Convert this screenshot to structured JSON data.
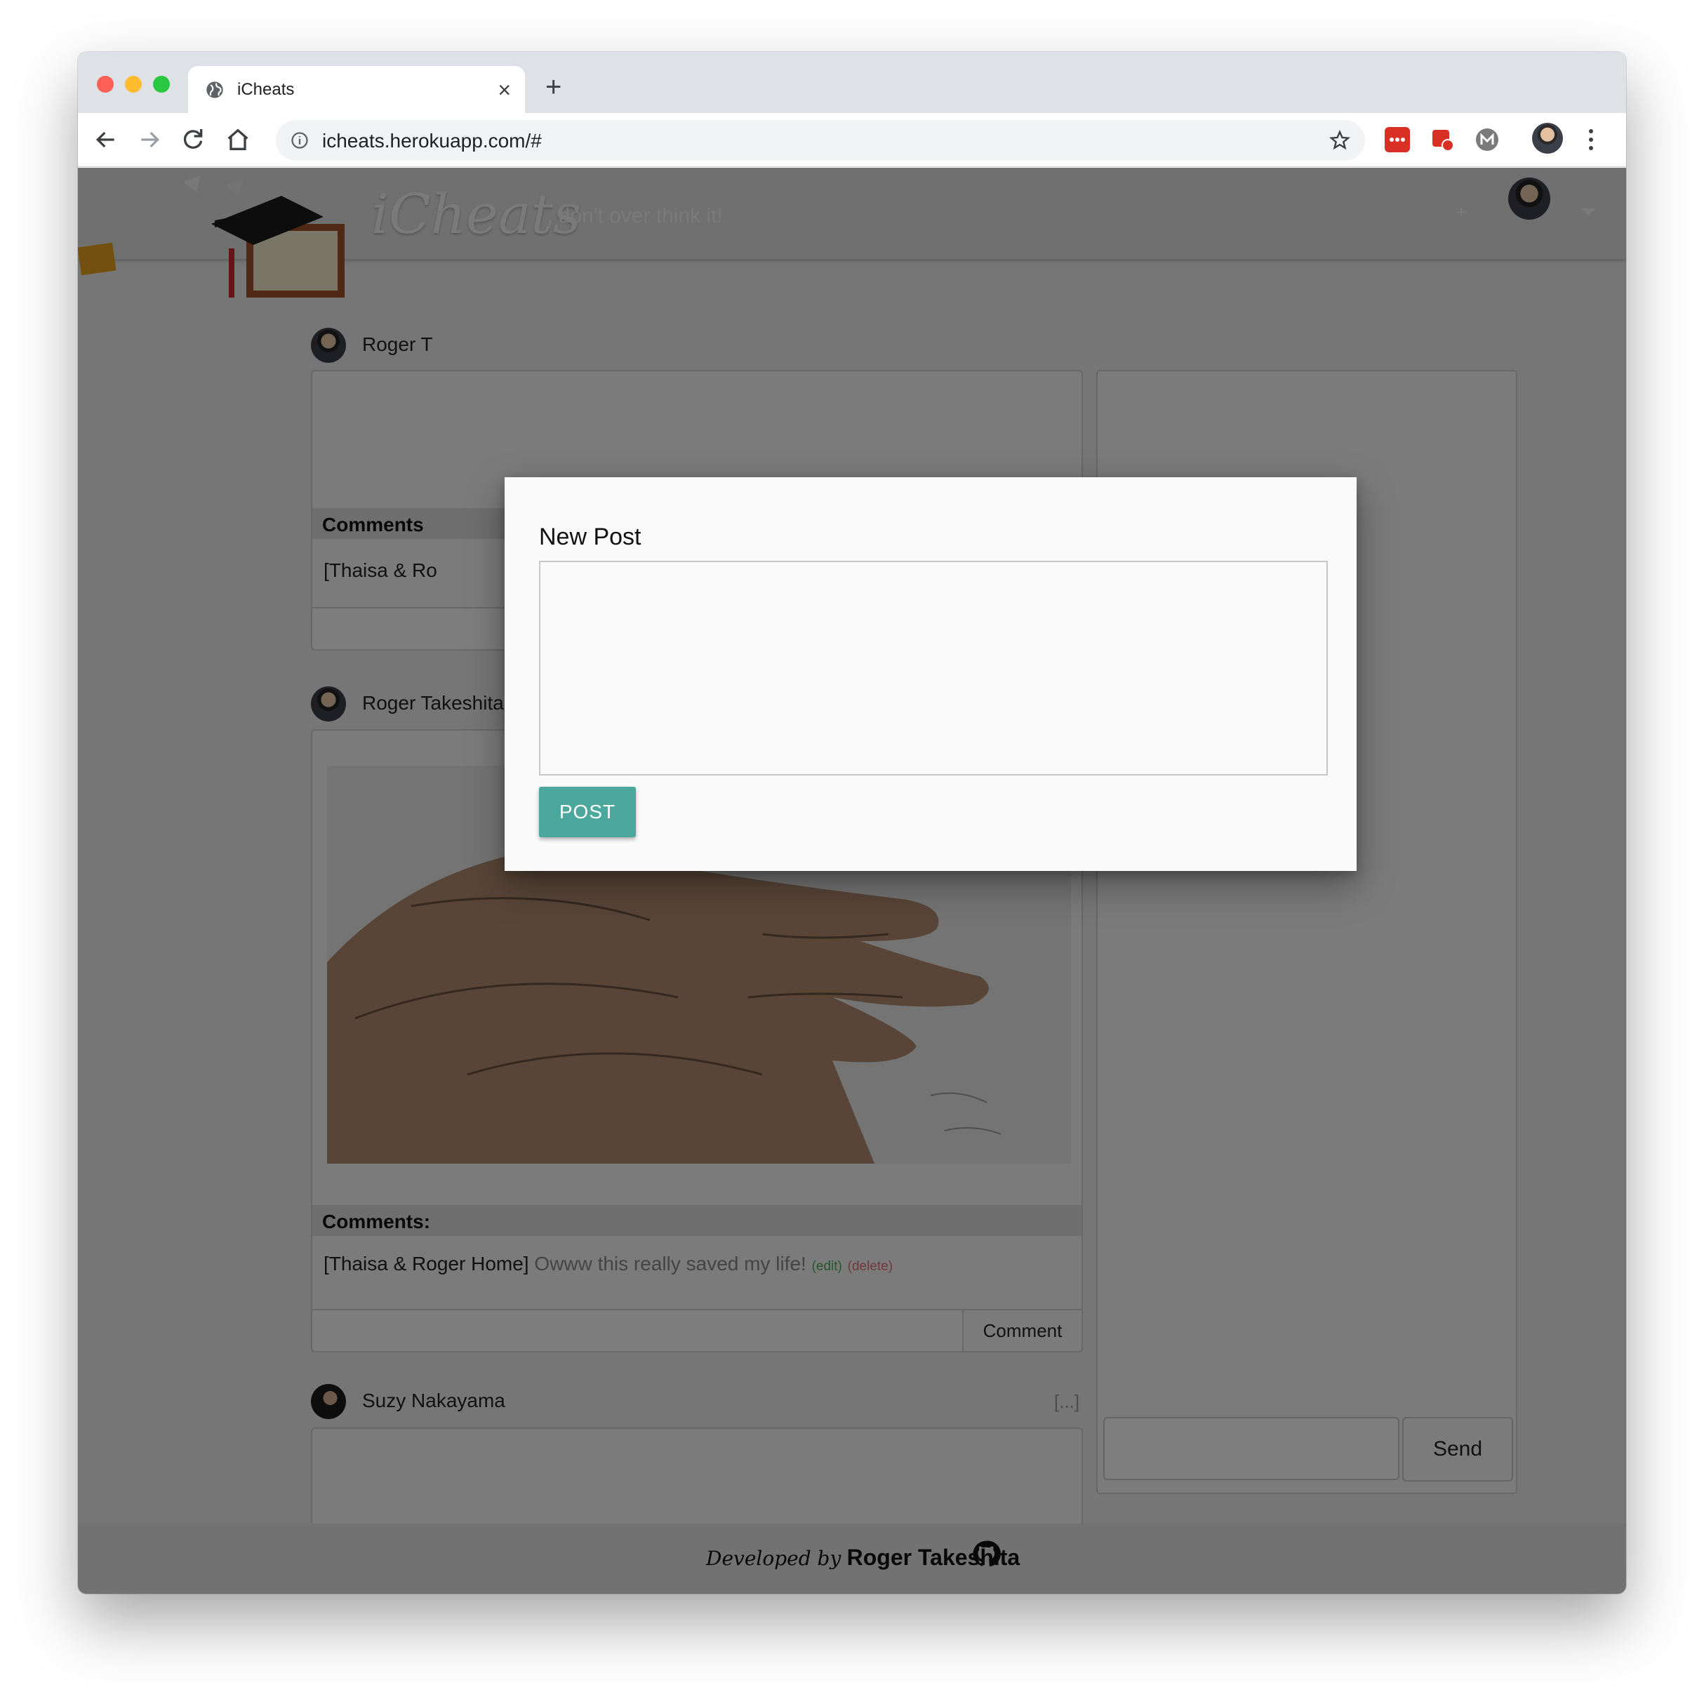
{
  "browser": {
    "tab_title": "iCheats",
    "url": "icheats.herokuapp.com/#",
    "new_tab_symbol": "+",
    "close_symbol": "×"
  },
  "header": {
    "logo": "iCheats",
    "tagline": ", don't over think it!",
    "add_symbol": "+"
  },
  "posts": [
    {
      "author": "Roger T",
      "comments_label": "Comments",
      "comment_preview": "[Thaisa & Ro"
    },
    {
      "author": "Roger Takeshita",
      "ellipsis": "[...]",
      "comments_label": "Comments:",
      "comment_author": "[Thaisa & Roger Home]",
      "comment_text": "Owww this really saved my life!",
      "edit_label": "(edit)",
      "delete_label": "(delete)",
      "comment_button": "Comment"
    },
    {
      "author": "Suzy Nakayama",
      "ellipsis": "[...]"
    }
  ],
  "chat": {
    "send_label": "Send"
  },
  "footer": {
    "developed_by": "Developed by",
    "developer": "Roger Takeshita"
  },
  "modal": {
    "title": "New Post",
    "textarea_value": "",
    "post_button": "POST",
    "post_button_color": "#4ca79c"
  },
  "colors": {
    "overlay": "rgba(0,0,0,0.5)",
    "edit": "#4caf50",
    "delete": "#e57373"
  }
}
